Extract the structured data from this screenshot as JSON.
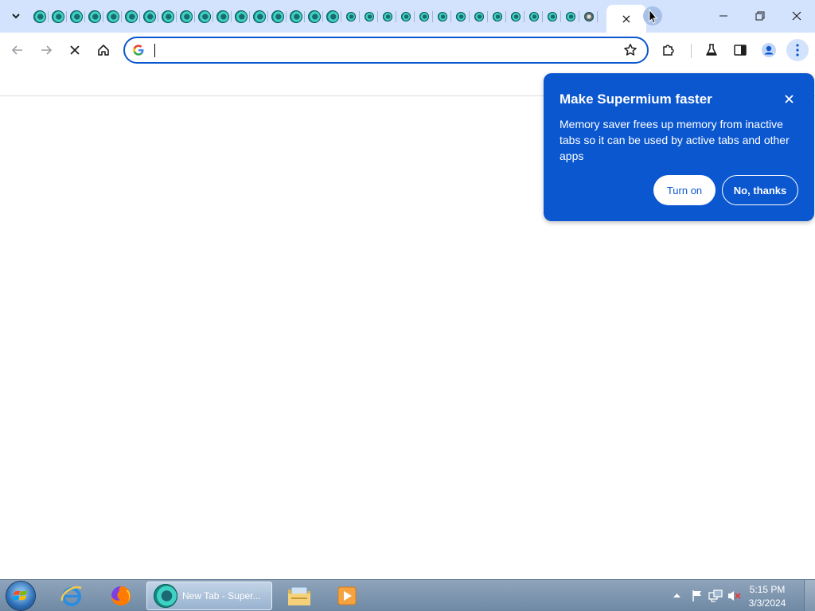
{
  "tabstrip": {
    "tab_count": 31,
    "active_tab_close": "×"
  },
  "toolbar": {
    "omnibox_value": "",
    "omnibox_placeholder": ""
  },
  "bubble": {
    "title": "Make Supermium faster",
    "body": "Memory saver frees up memory from inactive tabs so it can be used by active tabs and other apps",
    "turn_on_label": "Turn on",
    "no_thanks_label": "No, thanks",
    "close_label": "×"
  },
  "taskbar": {
    "active_window_label": "New Tab - Super...",
    "clock_time": "5:15 PM",
    "clock_date": "3/3/2024"
  },
  "colors": {
    "accent": "#0b57d0",
    "tabstrip_bg": "#d3e3fd",
    "taskbar_bg": "#7f96b0"
  }
}
